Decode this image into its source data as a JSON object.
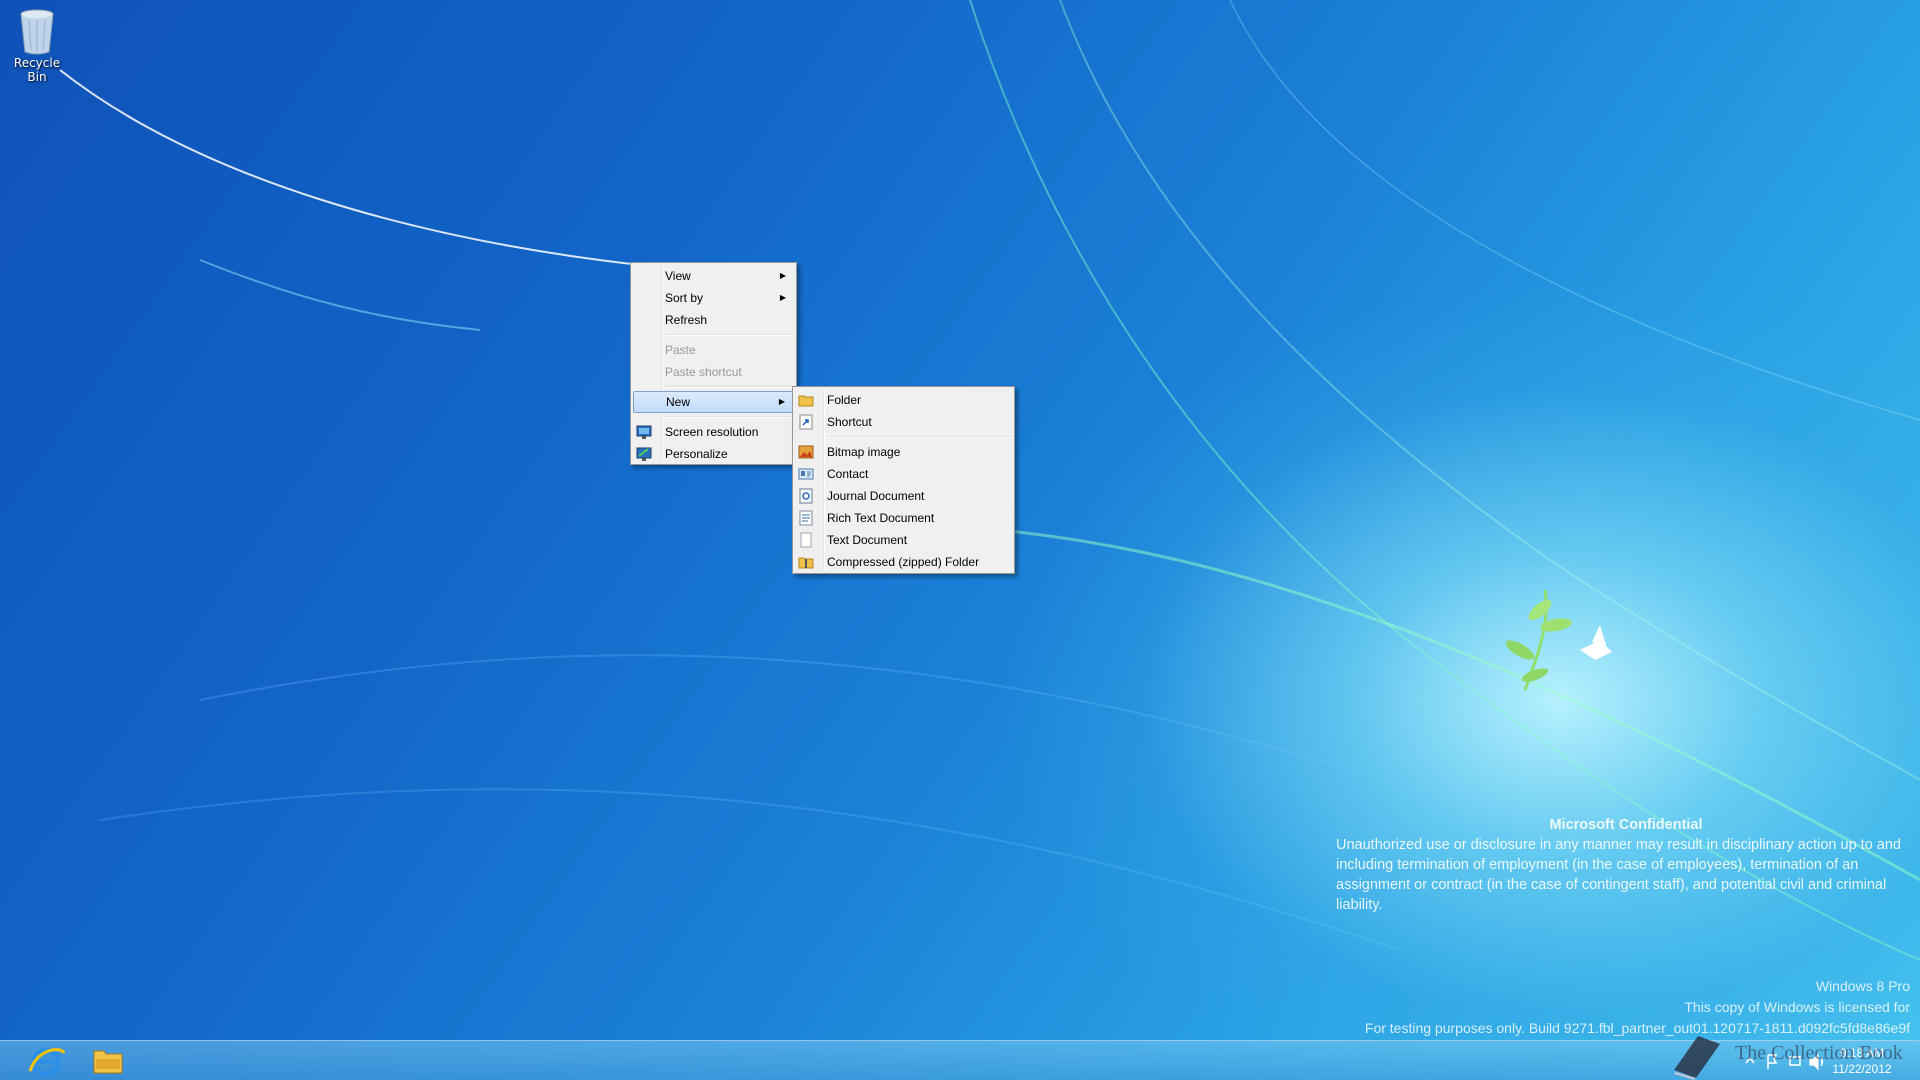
{
  "desktop": {
    "icons": [
      {
        "label": "Recycle Bin",
        "icon": "recycle-bin-icon"
      }
    ]
  },
  "context_menu": {
    "items": [
      {
        "label": "View",
        "has_submenu": true,
        "enabled": true
      },
      {
        "label": "Sort by",
        "has_submenu": true,
        "enabled": true
      },
      {
        "label": "Refresh",
        "has_submenu": false,
        "enabled": true
      },
      {
        "label": "Paste",
        "has_submenu": false,
        "enabled": false
      },
      {
        "label": "Paste shortcut",
        "has_submenu": false,
        "enabled": false
      },
      {
        "label": "New",
        "has_submenu": true,
        "enabled": true,
        "highlighted": true
      },
      {
        "label": "Screen resolution",
        "icon": "monitor-icon",
        "enabled": true
      },
      {
        "label": "Personalize",
        "icon": "personalize-icon",
        "enabled": true
      }
    ],
    "arrow_glyph": "▶"
  },
  "new_submenu": {
    "items": [
      {
        "label": "Folder",
        "icon": "folder-icon"
      },
      {
        "label": "Shortcut",
        "icon": "shortcut-icon"
      },
      {
        "label": "Bitmap image",
        "icon": "bitmap-icon"
      },
      {
        "label": "Contact",
        "icon": "contact-icon"
      },
      {
        "label": "Journal Document",
        "icon": "journal-icon"
      },
      {
        "label": "Rich Text Document",
        "icon": "rich-text-icon"
      },
      {
        "label": "Text Document",
        "icon": "text-document-icon"
      },
      {
        "label": "Compressed (zipped) Folder",
        "icon": "zip-folder-icon"
      }
    ]
  },
  "watermark": {
    "title": "Microsoft Confidential",
    "body": "Unauthorized use or disclosure in any manner may result in disciplinary action up to and including termination of employment (in the case of employees), termination of an assignment or contract (in the case of contingent staff), and potential civil and criminal liability.",
    "edition": "Windows 8 Pro",
    "license": "This copy of Windows is licensed for",
    "build": "For testing purposes only. Build 9271.fbl_partner_out01.120717-1811.d092fc5fd8e86e9f"
  },
  "taskbar": {
    "pinned": [
      {
        "name": "internet-explorer-button",
        "icon": "internet-explorer-icon"
      },
      {
        "name": "file-explorer-button",
        "icon": "file-explorer-icon"
      }
    ],
    "clock_time": "9:18 AM",
    "clock_date": "11/22/2012",
    "overlay_logo": "The Collection Book"
  },
  "colors": {
    "menu_bg": "#f0f0f0",
    "menu_highlight": "#c1dbfc",
    "desktop_blue": "#1265c7"
  }
}
